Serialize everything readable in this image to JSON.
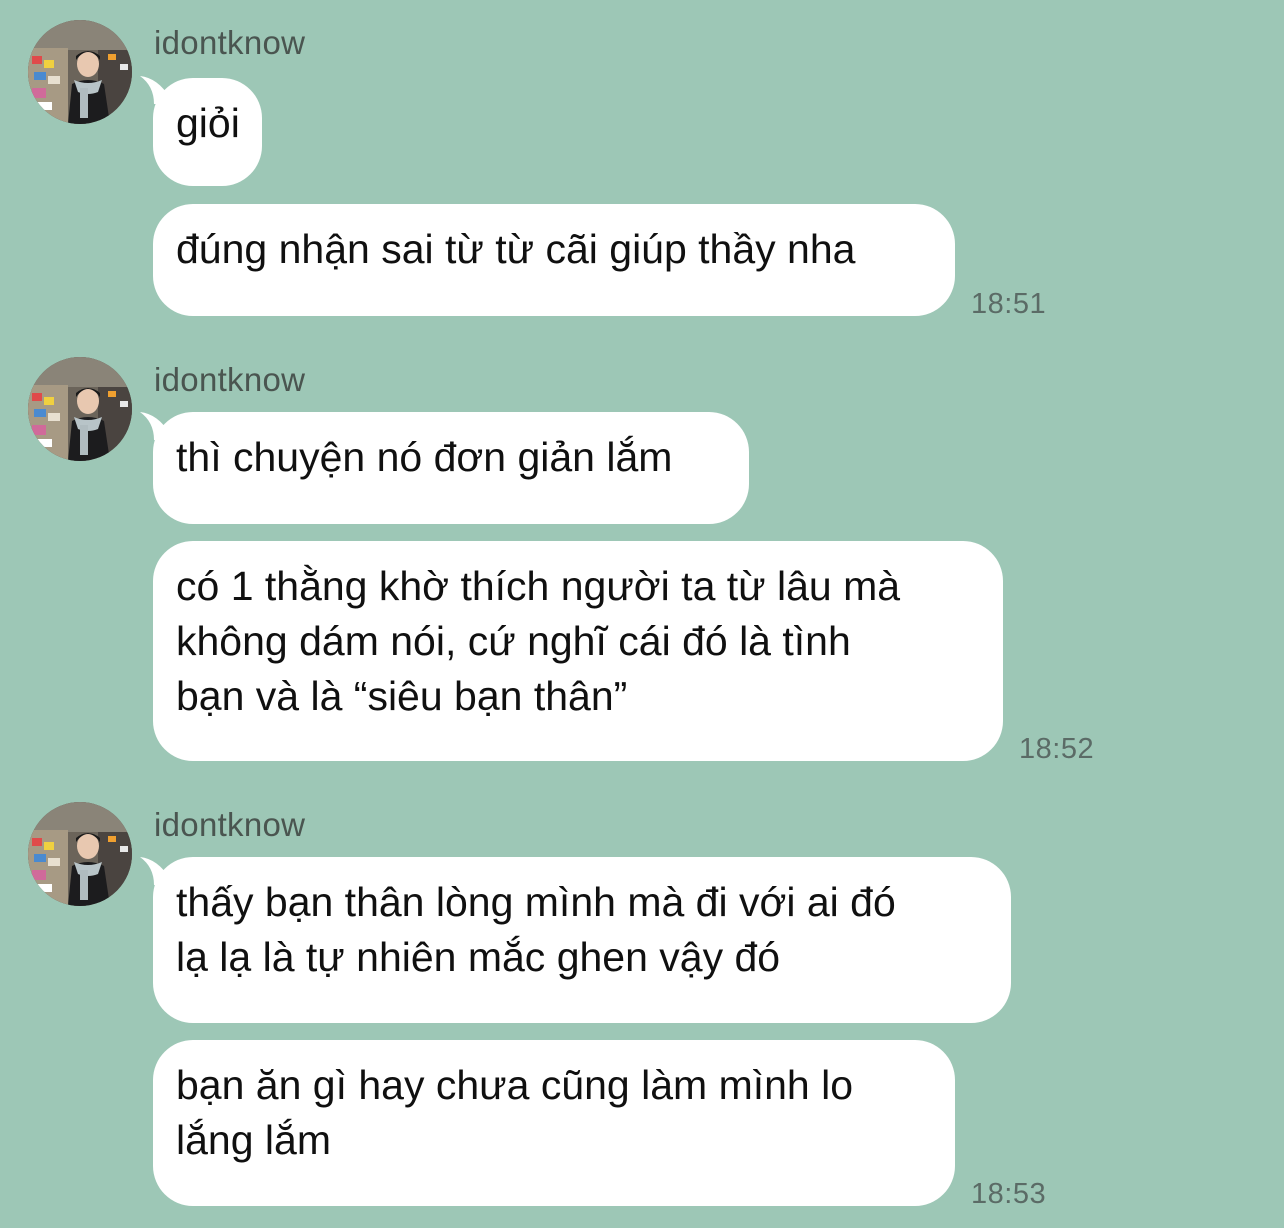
{
  "chat": {
    "groups": [
      {
        "sender": "idontknow",
        "avatar_icon": "user-photo-avatar",
        "messages": [
          {
            "lines": [
              "giỏi"
            ]
          },
          {
            "lines": [
              "đúng nhận sai từ từ cãi giúp thầy nha"
            ]
          }
        ],
        "time": "18:51"
      },
      {
        "sender": "idontknow",
        "avatar_icon": "user-photo-avatar",
        "messages": [
          {
            "lines": [
              "thì chuyện nó đơn giản lắm"
            ]
          },
          {
            "lines": [
              "có 1 thằng khờ thích người ta từ lâu mà",
              "không dám nói, cứ nghĩ cái đó là tình",
              "bạn và là “siêu bạn thân”"
            ]
          }
        ],
        "time": "18:52"
      },
      {
        "sender": "idontknow",
        "avatar_icon": "user-photo-avatar",
        "messages": [
          {
            "lines": [
              "thấy bạn thân lòng mình mà đi với ai đó",
              "lạ lạ là tự nhiên mắc ghen vậy đó"
            ]
          },
          {
            "lines": [
              "bạn ăn gì hay chưa cũng làm mình lo",
              "lắng lắm"
            ]
          }
        ],
        "time": "18:53"
      }
    ]
  },
  "colors": {
    "background": "#9dc7b6",
    "bubble": "#ffffff",
    "text": "#101010",
    "sender_name": "#4a5550",
    "timestamp": "#5b6b66"
  }
}
